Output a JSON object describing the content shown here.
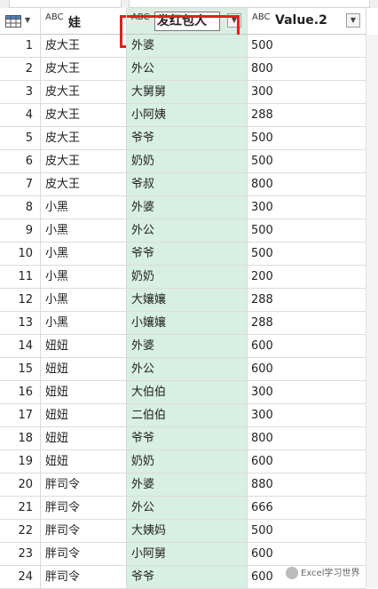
{
  "columns": [
    {
      "type": "ABC",
      "name": "娃"
    },
    {
      "type": "ABC",
      "name": "发红包人"
    },
    {
      "type": "ABC",
      "name": "Value.2"
    }
  ],
  "dropdown_glyph": "▼",
  "rows": [
    {
      "n": "1",
      "wa": "皮大王",
      "giver": "外婆",
      "value": "500"
    },
    {
      "n": "2",
      "wa": "皮大王",
      "giver": "外公",
      "value": "800"
    },
    {
      "n": "3",
      "wa": "皮大王",
      "giver": "大舅舅",
      "value": "300"
    },
    {
      "n": "4",
      "wa": "皮大王",
      "giver": "小阿姨",
      "value": "288"
    },
    {
      "n": "5",
      "wa": "皮大王",
      "giver": "爷爷",
      "value": "500"
    },
    {
      "n": "6",
      "wa": "皮大王",
      "giver": "奶奶",
      "value": "500"
    },
    {
      "n": "7",
      "wa": "皮大王",
      "giver": "爷叔",
      "value": "800"
    },
    {
      "n": "8",
      "wa": "小黑",
      "giver": "外婆",
      "value": "300"
    },
    {
      "n": "9",
      "wa": "小黑",
      "giver": "外公",
      "value": "500"
    },
    {
      "n": "10",
      "wa": "小黑",
      "giver": "爷爷",
      "value": "500"
    },
    {
      "n": "11",
      "wa": "小黑",
      "giver": "奶奶",
      "value": "200"
    },
    {
      "n": "12",
      "wa": "小黑",
      "giver": "大孃孃",
      "value": "288"
    },
    {
      "n": "13",
      "wa": "小黑",
      "giver": "小孃孃",
      "value": "288"
    },
    {
      "n": "14",
      "wa": "妞妞",
      "giver": "外婆",
      "value": "600"
    },
    {
      "n": "15",
      "wa": "妞妞",
      "giver": "外公",
      "value": "600"
    },
    {
      "n": "16",
      "wa": "妞妞",
      "giver": "大伯伯",
      "value": "300"
    },
    {
      "n": "17",
      "wa": "妞妞",
      "giver": "二伯伯",
      "value": "300"
    },
    {
      "n": "18",
      "wa": "妞妞",
      "giver": "爷爷",
      "value": "800"
    },
    {
      "n": "19",
      "wa": "妞妞",
      "giver": "奶奶",
      "value": "600"
    },
    {
      "n": "20",
      "wa": "胖司令",
      "giver": "外婆",
      "value": "880"
    },
    {
      "n": "21",
      "wa": "胖司令",
      "giver": "外公",
      "value": "666"
    },
    {
      "n": "22",
      "wa": "胖司令",
      "giver": "大姨妈",
      "value": "500"
    },
    {
      "n": "23",
      "wa": "胖司令",
      "giver": "小阿舅",
      "value": "600"
    },
    {
      "n": "24",
      "wa": "胖司令",
      "giver": "爷爷",
      "value": "600"
    }
  ],
  "watermark": "Excel学习世界",
  "colors": {
    "highlight_border": "#e02020",
    "selected_column": "#d8efe3"
  }
}
